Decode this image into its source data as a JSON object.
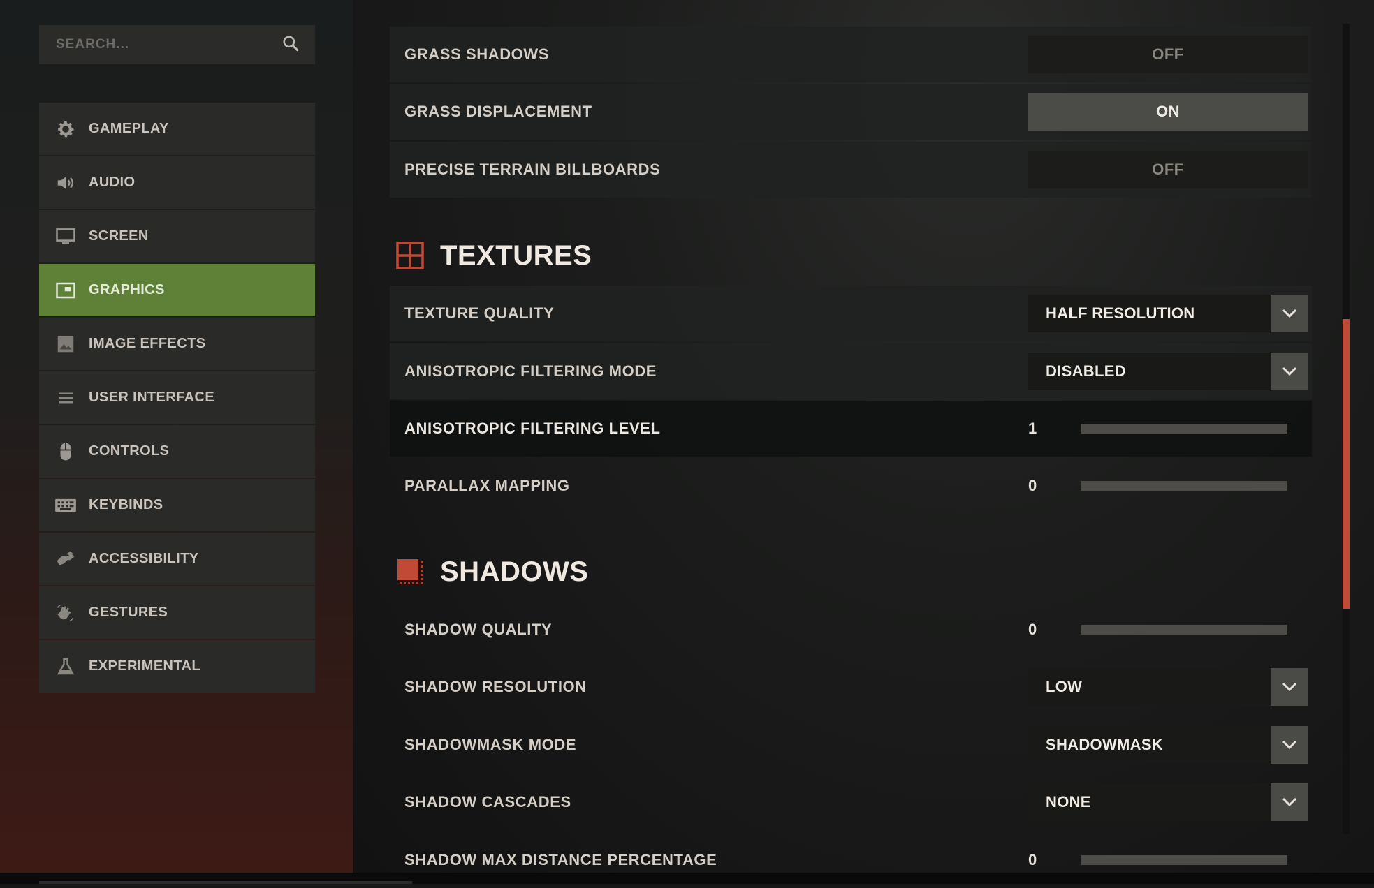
{
  "search": {
    "placeholder": "SEARCH..."
  },
  "sidebar": {
    "items": [
      {
        "label": "GAMEPLAY",
        "icon": "gear-icon"
      },
      {
        "label": "AUDIO",
        "icon": "speaker-icon"
      },
      {
        "label": "SCREEN",
        "icon": "monitor-icon"
      },
      {
        "label": "GRAPHICS",
        "icon": "graphics-icon",
        "active": true
      },
      {
        "label": "IMAGE EFFECTS",
        "icon": "image-icon"
      },
      {
        "label": "USER INTERFACE",
        "icon": "menu-lines-icon"
      },
      {
        "label": "CONTROLS",
        "icon": "mouse-icon"
      },
      {
        "label": "KEYBINDS",
        "icon": "keyboard-icon"
      },
      {
        "label": "ACCESSIBILITY",
        "icon": "accessibility-hand-icon"
      },
      {
        "label": "GESTURES",
        "icon": "waving-hand-icon"
      },
      {
        "label": "EXPERIMENTAL",
        "icon": "flask-icon"
      }
    ]
  },
  "colors": {
    "active_nav": "#5f8037",
    "accent_red": "#c04a36",
    "toggle_on": "#4b4b48"
  },
  "settings": {
    "grass_shadows": {
      "label": "GRASS SHADOWS",
      "value": "OFF"
    },
    "grass_displacement": {
      "label": "GRASS DISPLACEMENT",
      "value": "ON"
    },
    "precise_terrain_billboards": {
      "label": "PRECISE TERRAIN BILLBOARDS",
      "value": "OFF"
    },
    "textures": {
      "title": "TEXTURES",
      "icon": "grid-icon",
      "texture_quality": {
        "label": "TEXTURE QUALITY",
        "value": "HALF RESOLUTION"
      },
      "anisotropic_filtering_mode": {
        "label": "ANISOTROPIC FILTERING MODE",
        "value": "DISABLED"
      },
      "anisotropic_filtering_level": {
        "label": "ANISOTROPIC FILTERING LEVEL",
        "value": "1"
      },
      "parallax_mapping": {
        "label": "PARALLAX MAPPING",
        "value": "0"
      }
    },
    "shadows": {
      "title": "SHADOWS",
      "icon": "shadow-square-icon",
      "shadow_quality": {
        "label": "SHADOW QUALITY",
        "value": "0"
      },
      "shadow_resolution": {
        "label": "SHADOW RESOLUTION",
        "value": "LOW"
      },
      "shadowmask_mode": {
        "label": "SHADOWMASK MODE",
        "value": "SHADOWMASK"
      },
      "shadow_cascades": {
        "label": "SHADOW CASCADES",
        "value": "NONE"
      },
      "shadow_max_distance_percentage": {
        "label": "SHADOW MAX DISTANCE PERCENTAGE",
        "value": "0"
      }
    }
  }
}
